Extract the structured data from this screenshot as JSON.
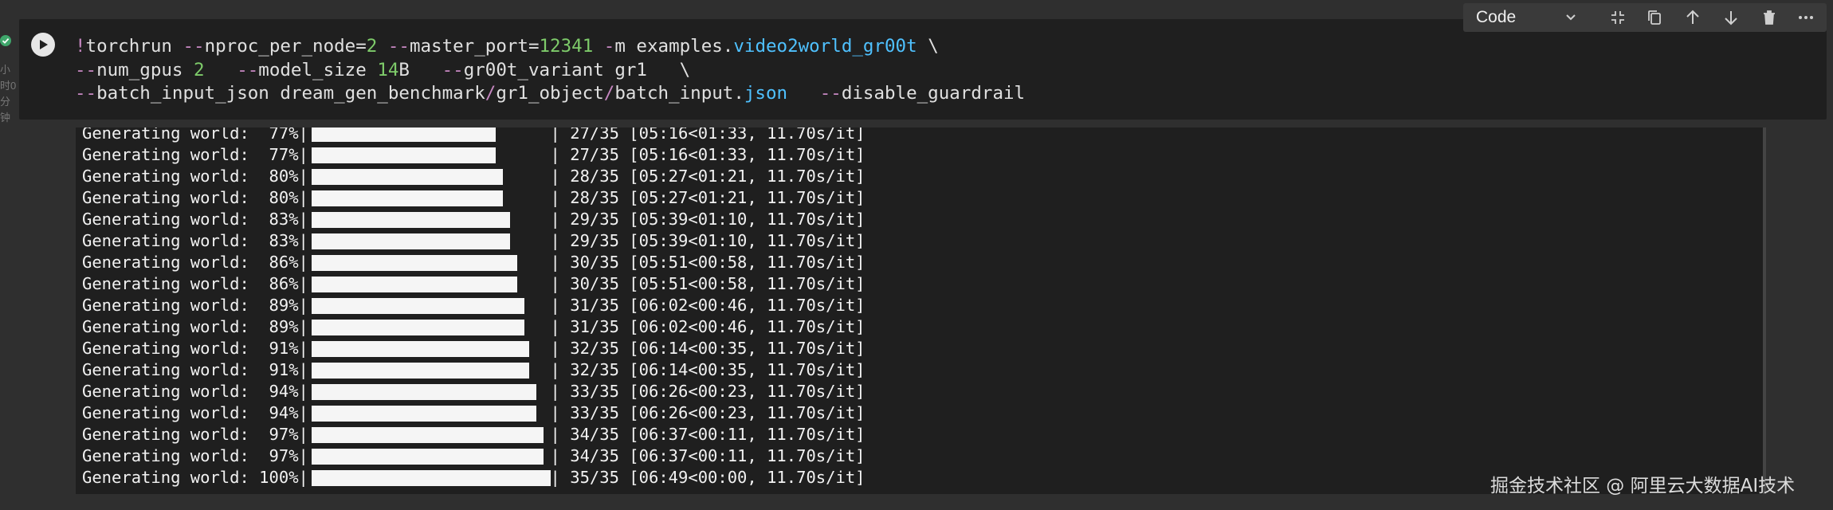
{
  "gutter": {
    "exec_time_chars": [
      "小",
      "时0",
      "分",
      "钟"
    ]
  },
  "toolbar": {
    "language": "Code",
    "icons": [
      "chevron-down-icon",
      "collapse-icon",
      "copy-icon",
      "arrow-up-icon",
      "arrow-down-icon",
      "trash-icon",
      "more-icon"
    ]
  },
  "cell": {
    "lines": [
      [
        {
          "t": "!",
          "c": "tk-bang"
        },
        {
          "t": "torchrun "
        },
        {
          "t": "--",
          "c": "tk-flag"
        },
        {
          "t": "nproc_per_node="
        },
        {
          "t": "2",
          "c": "tk-num"
        },
        {
          "t": " "
        },
        {
          "t": "--",
          "c": "tk-flag"
        },
        {
          "t": "master_port="
        },
        {
          "t": "12341",
          "c": "tk-num"
        },
        {
          "t": " "
        },
        {
          "t": "-",
          "c": "tk-flag"
        },
        {
          "t": "m examples."
        },
        {
          "t": "video2world_gr00t",
          "c": "tk-blue"
        },
        {
          "t": " \\"
        }
      ],
      [
        {
          "t": "--",
          "c": "tk-flag"
        },
        {
          "t": "num_gpus "
        },
        {
          "t": "2",
          "c": "tk-num"
        },
        {
          "t": "   "
        },
        {
          "t": "--",
          "c": "tk-flag"
        },
        {
          "t": "model_size "
        },
        {
          "t": "14",
          "c": "tk-num"
        },
        {
          "t": "B   "
        },
        {
          "t": "--",
          "c": "tk-flag"
        },
        {
          "t": "gr00t_variant gr1   \\"
        }
      ],
      [
        {
          "t": "--",
          "c": "tk-flag"
        },
        {
          "t": "batch_input_json dream_gen_benchmark"
        },
        {
          "t": "/",
          "c": "tk-slash"
        },
        {
          "t": "gr1_object"
        },
        {
          "t": "/",
          "c": "tk-slash"
        },
        {
          "t": "batch_input."
        },
        {
          "t": "json",
          "c": "tk-blue"
        },
        {
          "t": "   "
        },
        {
          "t": "--",
          "c": "tk-flag"
        },
        {
          "t": "disable_guardrail"
        }
      ]
    ]
  },
  "output": {
    "label": "Generating world:",
    "rows": [
      {
        "pct": "77%",
        "fraction": 0.77,
        "count": "27/35",
        "timing": "[05:16<01:33, 11.70s/it]"
      },
      {
        "pct": "77%",
        "fraction": 0.77,
        "count": "27/35",
        "timing": "[05:16<01:33, 11.70s/it]"
      },
      {
        "pct": "80%",
        "fraction": 0.8,
        "count": "28/35",
        "timing": "[05:27<01:21, 11.70s/it]"
      },
      {
        "pct": "80%",
        "fraction": 0.8,
        "count": "28/35",
        "timing": "[05:27<01:21, 11.70s/it]"
      },
      {
        "pct": "83%",
        "fraction": 0.83,
        "count": "29/35",
        "timing": "[05:39<01:10, 11.70s/it]"
      },
      {
        "pct": "83%",
        "fraction": 0.83,
        "count": "29/35",
        "timing": "[05:39<01:10, 11.70s/it]"
      },
      {
        "pct": "86%",
        "fraction": 0.86,
        "count": "30/35",
        "timing": "[05:51<00:58, 11.70s/it]"
      },
      {
        "pct": "86%",
        "fraction": 0.86,
        "count": "30/35",
        "timing": "[05:51<00:58, 11.70s/it]"
      },
      {
        "pct": "89%",
        "fraction": 0.89,
        "count": "31/35",
        "timing": "[06:02<00:46, 11.70s/it]"
      },
      {
        "pct": "89%",
        "fraction": 0.89,
        "count": "31/35",
        "timing": "[06:02<00:46, 11.70s/it]"
      },
      {
        "pct": "91%",
        "fraction": 0.91,
        "count": "32/35",
        "timing": "[06:14<00:35, 11.70s/it]"
      },
      {
        "pct": "91%",
        "fraction": 0.91,
        "count": "32/35",
        "timing": "[06:14<00:35, 11.70s/it]"
      },
      {
        "pct": "94%",
        "fraction": 0.94,
        "count": "33/35",
        "timing": "[06:26<00:23, 11.70s/it]"
      },
      {
        "pct": "94%",
        "fraction": 0.94,
        "count": "33/35",
        "timing": "[06:26<00:23, 11.70s/it]"
      },
      {
        "pct": "97%",
        "fraction": 0.97,
        "count": "34/35",
        "timing": "[06:37<00:11, 11.70s/it]"
      },
      {
        "pct": "97%",
        "fraction": 0.97,
        "count": "34/35",
        "timing": "[06:37<00:11, 11.70s/it]"
      },
      {
        "pct": "100%",
        "fraction": 1.0,
        "count": "35/35",
        "timing": "[06:49<00:00, 11.70s/it]"
      }
    ]
  },
  "watermark": "掘金技术社区 @ 阿里云大数据AI技术"
}
